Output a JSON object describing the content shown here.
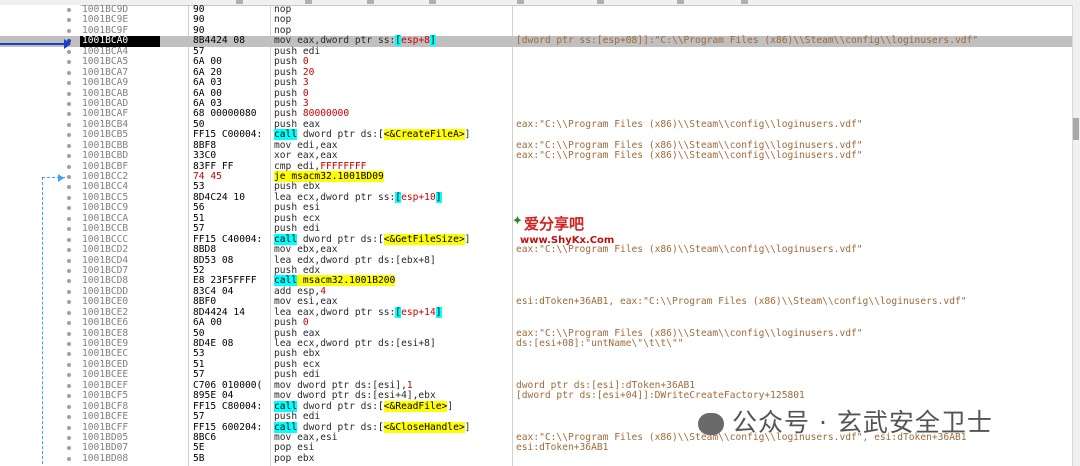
{
  "rows": [
    {
      "addr": "1001BC9D",
      "bytes": "90",
      "ins": [
        {
          "t": "nop",
          "c": "nop"
        }
      ],
      "cmt": ""
    },
    {
      "addr": "1001BC9E",
      "bytes": "90",
      "ins": [
        {
          "t": "nop",
          "c": "nop"
        }
      ],
      "cmt": ""
    },
    {
      "addr": "1001BC9F",
      "bytes": "90",
      "ins": [
        {
          "t": "nop",
          "c": "nop"
        }
      ],
      "cmt": ""
    },
    {
      "addr": "1001BCA0",
      "bytes": "8B4424 08",
      "sel": true,
      "ins": [
        {
          "t": "mov eax,dword ptr ss:"
        },
        {
          "t": "[",
          "c": "hl-c"
        },
        {
          "t": "esp+8",
          "c": "lbl"
        },
        {
          "t": "]",
          "c": "hl-c"
        }
      ],
      "cmt": "[dword ptr ss:[esp+08]]:\"C:\\\\Program Files (x86)\\\\Steam\\\\config\\\\loginusers.vdf\""
    },
    {
      "addr": "1001BCA4",
      "bytes": "57",
      "ins": [
        {
          "t": "push edi"
        }
      ],
      "cmt": ""
    },
    {
      "addr": "1001BCA5",
      "bytes": "6A 00",
      "ins": [
        {
          "t": "push "
        },
        {
          "t": "0",
          "c": "lbl"
        }
      ],
      "cmt": ""
    },
    {
      "addr": "1001BCA7",
      "bytes": "6A 20",
      "ins": [
        {
          "t": "push "
        },
        {
          "t": "20",
          "c": "lbl"
        }
      ],
      "cmt": ""
    },
    {
      "addr": "1001BCA9",
      "bytes": "6A 03",
      "ins": [
        {
          "t": "push "
        },
        {
          "t": "3",
          "c": "lbl"
        }
      ],
      "cmt": ""
    },
    {
      "addr": "1001BCAB",
      "bytes": "6A 00",
      "ins": [
        {
          "t": "push "
        },
        {
          "t": "0",
          "c": "lbl"
        }
      ],
      "cmt": ""
    },
    {
      "addr": "1001BCAD",
      "bytes": "6A 03",
      "ins": [
        {
          "t": "push "
        },
        {
          "t": "3",
          "c": "lbl"
        }
      ],
      "cmt": ""
    },
    {
      "addr": "1001BCAF",
      "bytes": "68 00000080",
      "ins": [
        {
          "t": "push "
        },
        {
          "t": "80000000",
          "c": "lbl"
        }
      ],
      "cmt": ""
    },
    {
      "addr": "1001BCB4",
      "bytes": "50",
      "ins": [
        {
          "t": "push eax"
        }
      ],
      "cmt": "eax:\"C:\\\\Program Files (x86)\\\\Steam\\\\config\\\\loginusers.vdf\""
    },
    {
      "addr": "1001BCB5",
      "bytes": "FF15 C00004:",
      "ins": [
        {
          "t": "call",
          "c": "hl-c"
        },
        {
          "t": " dword ptr ds:"
        },
        {
          "t": "[",
          "c": "b0"
        },
        {
          "t": "<&CreateFileA>",
          "c": "hl-y"
        },
        {
          "t": "]"
        }
      ],
      "cmt": ""
    },
    {
      "addr": "1001BCBB",
      "bytes": "8BF8",
      "ins": [
        {
          "t": "mov edi,eax"
        }
      ],
      "cmt": "eax:\"C:\\\\Program Files (x86)\\\\Steam\\\\config\\\\loginusers.vdf\""
    },
    {
      "addr": "1001BCBD",
      "bytes": "33C0",
      "ins": [
        {
          "t": "xor eax,eax"
        }
      ],
      "cmt": "eax:\"C:\\\\Program Files (x86)\\\\Steam\\\\config\\\\loginusers.vdf\""
    },
    {
      "addr": "1001BCBF",
      "bytes": "83FF FF",
      "ins": [
        {
          "t": "cmp edi,"
        },
        {
          "t": "FFFFFFFF",
          "c": "lbl"
        }
      ],
      "cmt": ""
    },
    {
      "addr": "1001BCC2",
      "bytes": "74 45",
      "red": true,
      "ins": [
        {
          "t": "je msacm32.1001BD09",
          "c": "hl-y"
        }
      ],
      "cmt": ""
    },
    {
      "addr": "1001BCC4",
      "bytes": "53",
      "ins": [
        {
          "t": "push ebx"
        }
      ],
      "cmt": ""
    },
    {
      "addr": "1001BCC5",
      "bytes": "8D4C24 10",
      "ins": [
        {
          "t": "lea ecx,dword ptr ss:"
        },
        {
          "t": "[",
          "c": "hl-c"
        },
        {
          "t": "esp+10",
          "c": "lbl"
        },
        {
          "t": "]",
          "c": "hl-c"
        }
      ],
      "cmt": ""
    },
    {
      "addr": "1001BCC9",
      "bytes": "56",
      "ins": [
        {
          "t": "push esi"
        }
      ],
      "cmt": ""
    },
    {
      "addr": "1001BCCA",
      "bytes": "51",
      "ins": [
        {
          "t": "push ecx"
        }
      ],
      "cmt": ""
    },
    {
      "addr": "1001BCCB",
      "bytes": "57",
      "ins": [
        {
          "t": "push edi"
        }
      ],
      "cmt": ""
    },
    {
      "addr": "1001BCCC",
      "bytes": "FF15 C40004:",
      "ins": [
        {
          "t": "call",
          "c": "hl-c"
        },
        {
          "t": " dword ptr ds:"
        },
        {
          "t": "[",
          "c": "b0"
        },
        {
          "t": "<&GetFileSize>",
          "c": "hl-y"
        },
        {
          "t": "]"
        }
      ],
      "cmt": ""
    },
    {
      "addr": "1001BCD2",
      "bytes": "8BD8",
      "ins": [
        {
          "t": "mov ebx,eax"
        }
      ],
      "cmt": "eax:\"C:\\\\Program Files (x86)\\\\Steam\\\\config\\\\loginusers.vdf\""
    },
    {
      "addr": "1001BCD4",
      "bytes": "8D53 08",
      "ins": [
        {
          "t": "lea edx,dword ptr ds:[ebx+8]"
        }
      ],
      "cmt": ""
    },
    {
      "addr": "1001BCD7",
      "bytes": "52",
      "ins": [
        {
          "t": "push edx"
        }
      ],
      "cmt": ""
    },
    {
      "addr": "1001BCD8",
      "bytes": "E8 23F5FFFF",
      "ins": [
        {
          "t": "call",
          "c": "hl-c"
        },
        {
          "t": " msacm32.1001B200",
          "c": "hl-y"
        }
      ],
      "cmt": ""
    },
    {
      "addr": "1001BCDD",
      "bytes": "83C4 04",
      "ins": [
        {
          "t": "add esp,"
        },
        {
          "t": "4",
          "c": "lbl"
        }
      ],
      "cmt": ""
    },
    {
      "addr": "1001BCE0",
      "bytes": "8BF0",
      "ins": [
        {
          "t": "mov esi,eax"
        }
      ],
      "cmt": "esi:dToken+36AB1, eax:\"C:\\\\Program Files (x86)\\\\Steam\\\\config\\\\loginusers.vdf\""
    },
    {
      "addr": "1001BCE2",
      "bytes": "8D4424 14",
      "ins": [
        {
          "t": "lea eax,dword ptr ss:"
        },
        {
          "t": "[",
          "c": "hl-c"
        },
        {
          "t": "esp+14",
          "c": "lbl"
        },
        {
          "t": "]",
          "c": "hl-c"
        }
      ],
      "cmt": ""
    },
    {
      "addr": "1001BCE6",
      "bytes": "6A 00",
      "ins": [
        {
          "t": "push "
        },
        {
          "t": "0",
          "c": "lbl"
        }
      ],
      "cmt": ""
    },
    {
      "addr": "1001BCE8",
      "bytes": "50",
      "ins": [
        {
          "t": "push eax"
        }
      ],
      "cmt": "eax:\"C:\\\\Program Files (x86)\\\\Steam\\\\config\\\\loginusers.vdf\""
    },
    {
      "addr": "1001BCE9",
      "bytes": "8D4E 08",
      "ins": [
        {
          "t": "lea ecx,dword ptr ds:[esi+8]"
        }
      ],
      "cmt": "ds:[esi+08]:\"untName\\\"\\t\\t\\\"\""
    },
    {
      "addr": "1001BCEC",
      "bytes": "53",
      "ins": [
        {
          "t": "push ebx"
        }
      ],
      "cmt": ""
    },
    {
      "addr": "1001BCED",
      "bytes": "51",
      "ins": [
        {
          "t": "push ecx"
        }
      ],
      "cmt": ""
    },
    {
      "addr": "1001BCEE",
      "bytes": "57",
      "ins": [
        {
          "t": "push edi"
        }
      ],
      "cmt": ""
    },
    {
      "addr": "1001BCEF",
      "bytes": "C706 010000(",
      "ins": [
        {
          "t": "mov dword ptr ds:[esi],"
        },
        {
          "t": "1",
          "c": "lbl"
        }
      ],
      "cmt": "dword ptr ds:[esi]:dToken+36AB1"
    },
    {
      "addr": "1001BCF5",
      "bytes": "895E 04",
      "ins": [
        {
          "t": "mov dword ptr ds:[esi+4],ebx"
        }
      ],
      "cmt": "[dword ptr ds:[esi+04]]:DWriteCreateFactory+125801"
    },
    {
      "addr": "1001BCF8",
      "bytes": "FF15 C80004:",
      "ins": [
        {
          "t": "call",
          "c": "hl-c"
        },
        {
          "t": " dword ptr ds:"
        },
        {
          "t": "[",
          "c": "b0"
        },
        {
          "t": "<&ReadFile>",
          "c": "hl-y"
        },
        {
          "t": "]"
        }
      ],
      "cmt": ""
    },
    {
      "addr": "1001BCFE",
      "bytes": "57",
      "ins": [
        {
          "t": "push edi"
        }
      ],
      "cmt": ""
    },
    {
      "addr": "1001BCFF",
      "bytes": "FF15 600204:",
      "ins": [
        {
          "t": "call",
          "c": "hl-c"
        },
        {
          "t": " dword ptr ds:"
        },
        {
          "t": "[",
          "c": "b0"
        },
        {
          "t": "<&CloseHandle>",
          "c": "hl-y"
        },
        {
          "t": "]"
        }
      ],
      "cmt": ""
    },
    {
      "addr": "1001BD05",
      "bytes": "8BC6",
      "ins": [
        {
          "t": "mov eax,esi"
        }
      ],
      "cmt": "eax:\"C:\\\\Program Files (x86)\\\\Steam\\\\config\\\\loginusers.vdf\", esi:dToken+36AB1"
    },
    {
      "addr": "1001BD07",
      "bytes": "5E",
      "ins": [
        {
          "t": "pop esi"
        }
      ],
      "cmt": "esi:dToken+36AB1"
    },
    {
      "addr": "1001BD08",
      "bytes": "5B",
      "ins": [
        {
          "t": "pop ebx"
        }
      ],
      "cmt": ""
    }
  ],
  "watermark_site": {
    "name": "爱分享吧",
    "url": "www.ShyKx.Com"
  },
  "watermark_account": {
    "text": "公众号 · 玄武安全卫士"
  },
  "colors": {
    "selected_row": "#c0c0c0",
    "call_highlight": "#00ffff",
    "target_highlight": "#ffff00",
    "comment": "#a06a3a",
    "arrow": "#1e3ec8"
  }
}
